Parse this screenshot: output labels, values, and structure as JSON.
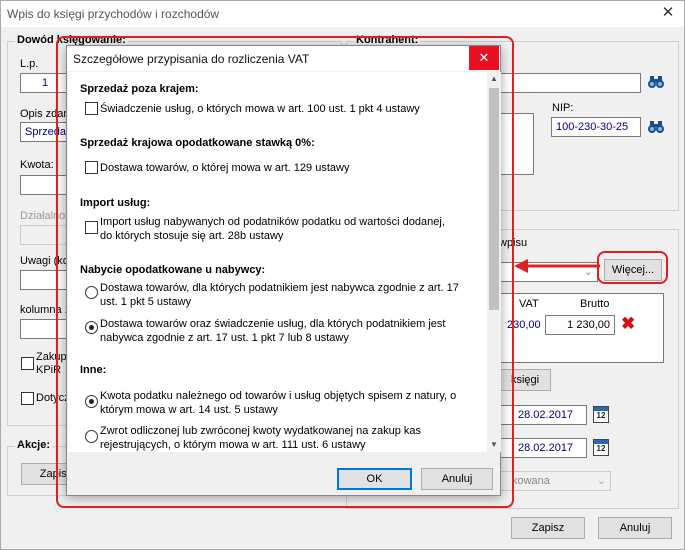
{
  "window": {
    "title": "Wpis do księgi przychodów i rozchodów",
    "close": "✕"
  },
  "left": {
    "document_section": "Dowód księgowanie:",
    "lp_label": "L.p.",
    "lp_value": "1",
    "opis_label": "Opis zdar",
    "opis_value": "Sprzedaż",
    "kwota_label": "Kwota:",
    "dzialalnosc_label": "Działalnoś",
    "uwagi_label": "Uwagi (ko",
    "kolumna_label": "kolumna 1",
    "zakup_label_1": "Zakup",
    "zakup_label_2": "KPiR",
    "dotycz_label": "Dotycz",
    "akcje_label": "Akcje:",
    "zapisz_left": "Zapisz"
  },
  "right": {
    "kontrahent_label": "Kontrahent:",
    "nip_label": "NIP:",
    "nip_value": "100-230-30-25",
    "wpisu_label": "wpisu",
    "wiecej_button": "Więcej...",
    "vat_header": "VAT",
    "brutto_header": "Brutto",
    "vat_value": "230,00",
    "brutto_value": "1 230,00",
    "delete_icon": "✖",
    "ksiegi_button": "księgi",
    "date1": "28.02.2017",
    "date2": "28.02.2017",
    "cal_text": "12",
    "combo_value": "kowana"
  },
  "bottom": {
    "zapisz": "Zapisz",
    "anuluj": "Anuluj"
  },
  "dialog": {
    "title": "Szczegółowe przypisania do rozliczenia VAT",
    "close": "✕",
    "sections": [
      {
        "title": "Sprzedaż poza krajem:"
      },
      {
        "title": "Sprzedaż krajowa opodatkowane stawką 0%:"
      },
      {
        "title": "Import usług:"
      },
      {
        "title": "Nabycie opodatkowane u nabywcy:"
      },
      {
        "title": "Inne:"
      }
    ],
    "options": {
      "o1": "Świadczenie usług, o których mowa w art. 100 ust. 1 pkt 4 ustawy",
      "o2": "Dostawa towarów, o której mowa w art. 129 ustawy",
      "o3": "Import usług nabywanych od podatników podatku od wartości dodanej, do których stosuje się art. 28b ustawy",
      "o4": "Dostawa towarów, dla których podatnikiem jest nabywca zgodnie z art. 17 ust. 1 pkt 5 ustawy",
      "o5": "Dostawa towarów oraz świadczenie usług, dla których podatnikiem jest nabywca zgodnie z art. 17 ust. 1 pkt 7 lub 8 ustawy",
      "o6": "Kwota podatku należnego od towarów i usług objętych spisem z natury, o którym mowa w art. 14 ust. 5 ustawy",
      "o7": "Zwrot odliczonej lub zwróconej kwoty wydatkowanej na zakup kas rejestrujących, o którym mowa w art. 111 ust. 6 ustawy"
    },
    "ok": "OK",
    "anuluj": "Anuluj"
  },
  "colors": {
    "highlight": "#e02020",
    "accent": "#0078d7",
    "value_text": "#000080"
  }
}
